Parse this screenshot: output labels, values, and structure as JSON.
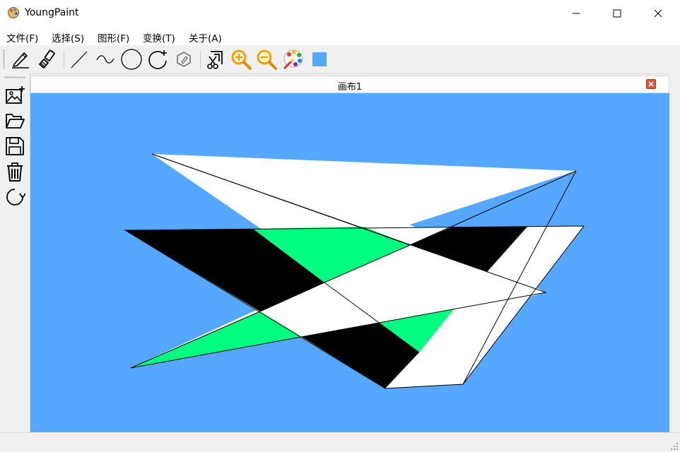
{
  "window": {
    "title": "YoungPaint",
    "icons": {
      "app": "palette-app-icon",
      "minimize": "minimize-icon",
      "maximize": "maximize-icon",
      "close": "close-icon"
    }
  },
  "menu": [
    "文件(F)",
    "选择(S)",
    "图形(F)",
    "变换(T)",
    "关于(A)"
  ],
  "toolbar": {
    "tools": [
      "pencil-icon",
      "brush-icon",
      "line-icon",
      "curve-icon",
      "circle-icon",
      "polygon-icon",
      "crop-icon",
      "cut-icon",
      "zoom-in-icon",
      "zoom-out-icon",
      "palette-icon",
      "color-swatch"
    ],
    "current_color": "#55a7ff"
  },
  "left_toolbar": [
    "new-image-icon",
    "open-folder-icon",
    "save-icon",
    "delete-icon",
    "rotate-icon"
  ],
  "canvas": {
    "tab_title": "画布1",
    "background": "#55a7ff",
    "shape_colors": {
      "fill_white": "#ffffff",
      "fill_black": "#000000",
      "fill_green": "#00ff80"
    }
  }
}
